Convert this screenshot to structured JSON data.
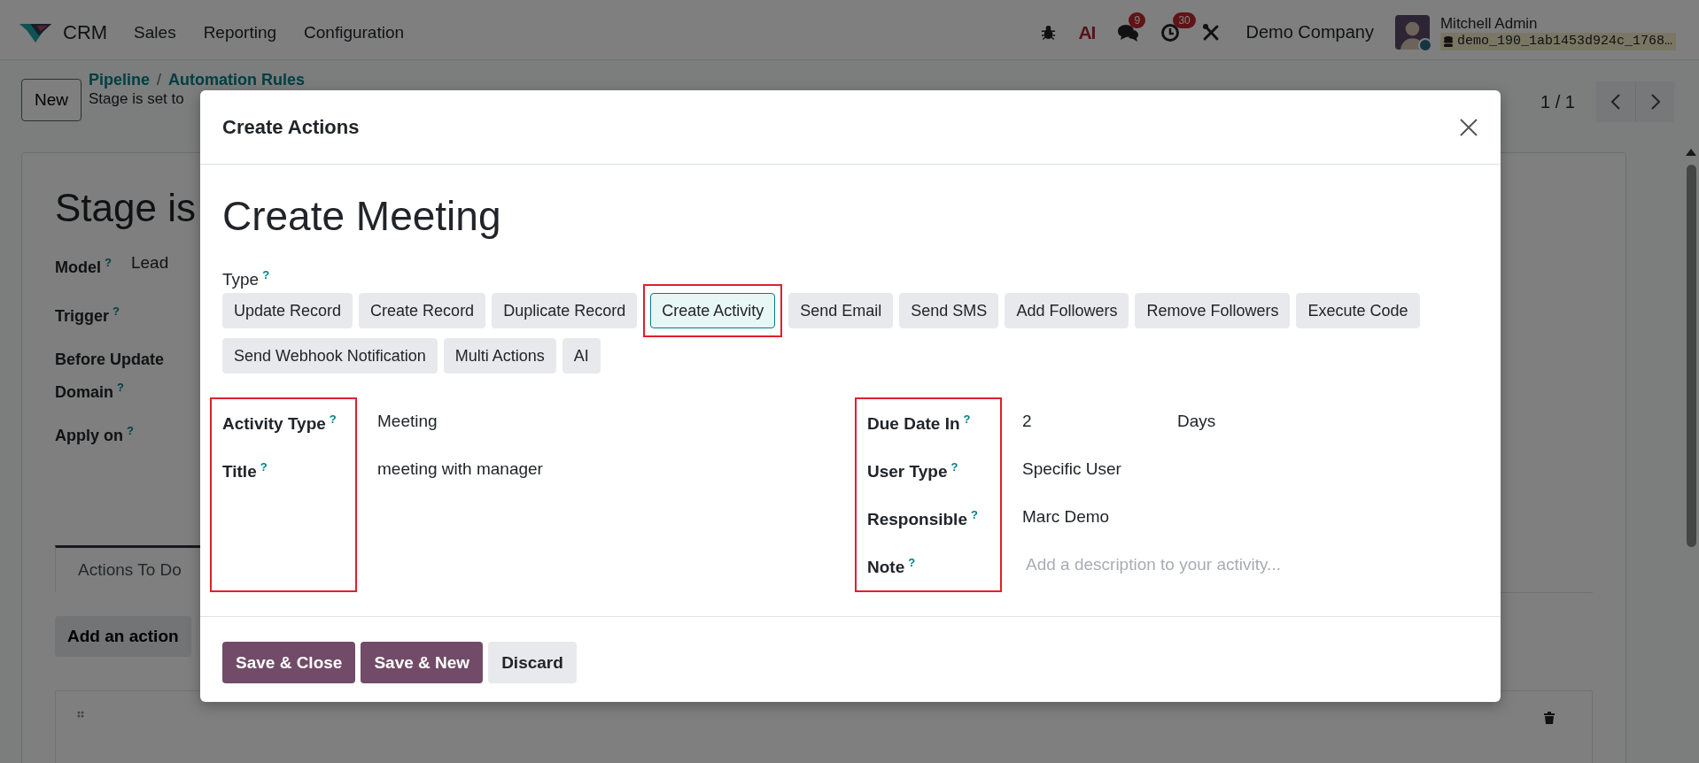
{
  "navbar": {
    "app_name": "CRM",
    "menus": [
      "Sales",
      "Reporting",
      "Configuration"
    ],
    "ai_label": "AI",
    "messages_badge": "9",
    "activities_badge": "30",
    "company": "Demo Company",
    "user_name": "Mitchell Admin",
    "database": "demo_190_1ab1453d924c_1768…"
  },
  "control_panel": {
    "new_button": "New",
    "breadcrumb": [
      "Pipeline",
      "Automation Rules"
    ],
    "separator": "/",
    "record_name": "Stage is set to",
    "pager": "1 / 1"
  },
  "form": {
    "title": "Stage is",
    "fields": [
      {
        "label": "Model",
        "help": "?",
        "value": "Lead"
      },
      {
        "label": "Trigger",
        "help": "?"
      },
      {
        "label": "Before Update Domain",
        "help": "?"
      },
      {
        "label": "Apply on",
        "help": "?"
      }
    ],
    "tabs": [
      {
        "label": "Actions To Do",
        "selected": true
      }
    ],
    "add_button": "Add an action"
  },
  "dialog": {
    "title": "Create Actions",
    "heading": "Create Meeting",
    "type_label": "Type",
    "type_help": "?",
    "types": [
      {
        "label": "Update Record",
        "selected": false,
        "highlighted": false
      },
      {
        "label": "Create Record",
        "selected": false,
        "highlighted": false
      },
      {
        "label": "Duplicate Record",
        "selected": false,
        "highlighted": false
      },
      {
        "label": "Create Activity",
        "selected": true,
        "highlighted": true
      },
      {
        "label": "Send Email",
        "selected": false,
        "highlighted": false
      },
      {
        "label": "Send SMS",
        "selected": false,
        "highlighted": false
      },
      {
        "label": "Add Followers",
        "selected": false,
        "highlighted": false
      },
      {
        "label": "Remove Followers",
        "selected": false,
        "highlighted": false
      },
      {
        "label": "Execute Code",
        "selected": false,
        "highlighted": false
      },
      {
        "label": "Send Webhook Notification",
        "selected": false,
        "highlighted": false
      },
      {
        "label": "Multi Actions",
        "selected": false,
        "highlighted": false
      },
      {
        "label": "AI",
        "selected": false,
        "highlighted": false
      }
    ],
    "left_group": {
      "highlighted": true,
      "fields": [
        {
          "label": "Activity Type",
          "help": "?",
          "value": "Meeting"
        },
        {
          "label": "Title",
          "help": "?",
          "value": "meeting with manager"
        }
      ]
    },
    "right_group": {
      "highlighted": true,
      "fields": [
        {
          "label": "Due Date In",
          "help": "?",
          "value": "2",
          "unit": "Days"
        },
        {
          "label": "User Type",
          "help": "?",
          "value": "Specific User"
        },
        {
          "label": "Responsible",
          "help": "?",
          "value": "Marc Demo"
        },
        {
          "label": "Note",
          "help": "?",
          "placeholder": "Add a description to your activity..."
        }
      ]
    },
    "buttons": [
      {
        "label": "Save & Close",
        "kind": "primary"
      },
      {
        "label": "Save & New",
        "kind": "primary"
      },
      {
        "label": "Discard",
        "kind": "secondary"
      }
    ]
  }
}
